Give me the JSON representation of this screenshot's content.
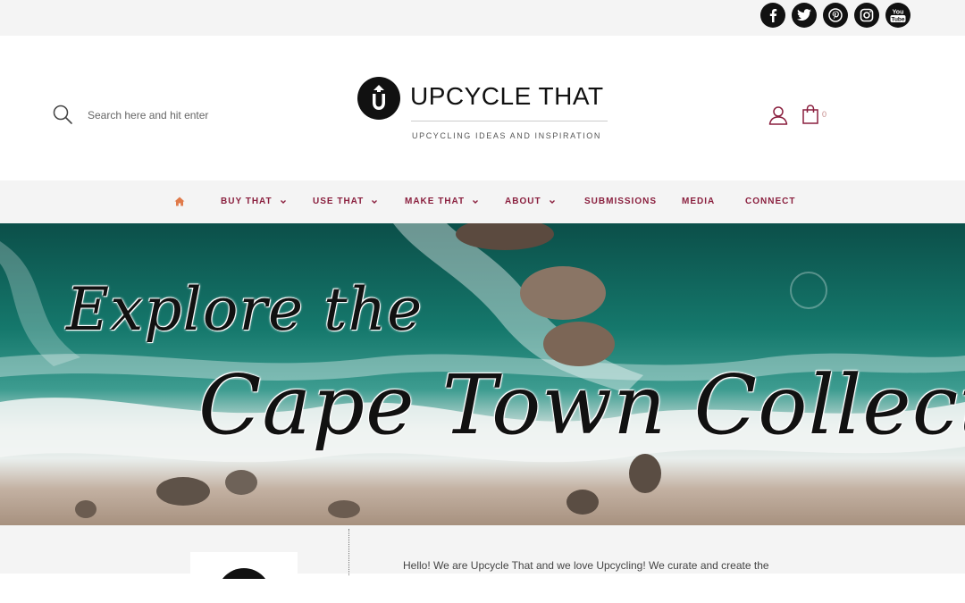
{
  "social": {
    "icons": [
      "facebook-icon",
      "twitter-icon",
      "pinterest-icon",
      "instagram-icon",
      "youtube-icon"
    ],
    "youtube_text_top": "You",
    "youtube_text_bottom": "Tube"
  },
  "header": {
    "search_placeholder": "Search here and hit enter",
    "logo_title": "UPCYCLE THAT",
    "logo_tagline": "UPCYCLING IDEAS AND INSPIRATION",
    "cart_count": "0"
  },
  "nav": {
    "items": [
      {
        "label": "BUY THAT",
        "has_dropdown": true
      },
      {
        "label": "USE THAT",
        "has_dropdown": true
      },
      {
        "label": "MAKE THAT",
        "has_dropdown": true
      },
      {
        "label": "ABOUT",
        "has_dropdown": true
      },
      {
        "label": "SUBMISSIONS",
        "has_dropdown": false
      },
      {
        "label": "MEDIA",
        "has_dropdown": false
      },
      {
        "label": "CONNECT",
        "has_dropdown": false
      }
    ]
  },
  "hero": {
    "line1": "Explore the",
    "line2": "Cape Town Collection"
  },
  "intro": {
    "text": "Hello! We are Upcycle That and we love Upcycling! We curate and create the"
  },
  "colors": {
    "accent": "#8a1f3e",
    "home_icon": "#e07a4a",
    "topbar_bg": "#f4f4f4",
    "nav_bg": "#f4f4f4"
  }
}
